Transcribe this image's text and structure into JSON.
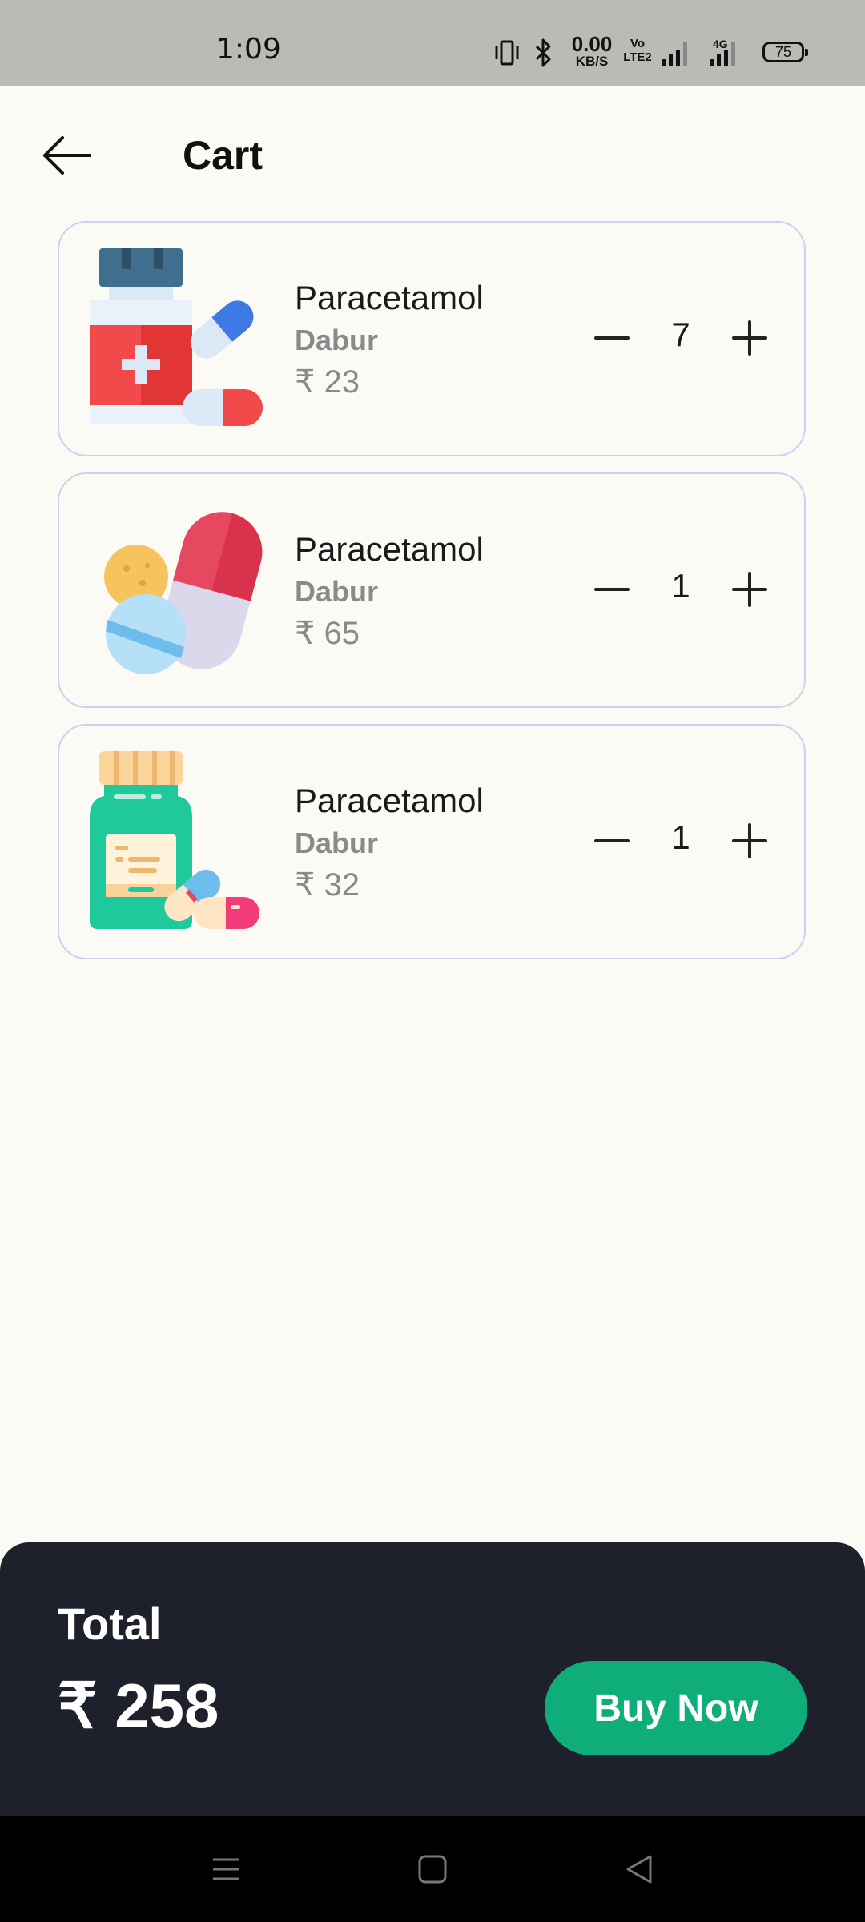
{
  "status_bar": {
    "time": "1:09",
    "net_speed_value": "0.00",
    "net_speed_unit": "KB/S",
    "volte_label": "Vo LTE2",
    "network_type": "4G",
    "battery_level": "75"
  },
  "header": {
    "title": "Cart"
  },
  "cart": {
    "items": [
      {
        "name": "Paracetamol",
        "brand": "Dabur",
        "price": "₹ 23",
        "quantity": "7",
        "image_icon": "medicine-bottle-pills-icon"
      },
      {
        "name": "Paracetamol",
        "brand": "Dabur",
        "price": "₹ 65",
        "quantity": "1",
        "image_icon": "capsule-tablets-icon"
      },
      {
        "name": "Paracetamol",
        "brand": "Dabur",
        "price": "₹ 32",
        "quantity": "1",
        "image_icon": "syrup-jar-pills-icon"
      }
    ]
  },
  "checkout": {
    "total_label": "Total",
    "total_amount": "₹ 258",
    "buy_label": "Buy Now"
  },
  "colors": {
    "background": "#fbfaf4",
    "card_border": "#d3cdf3",
    "panel": "#1e212c",
    "accent": "#0fad79"
  }
}
